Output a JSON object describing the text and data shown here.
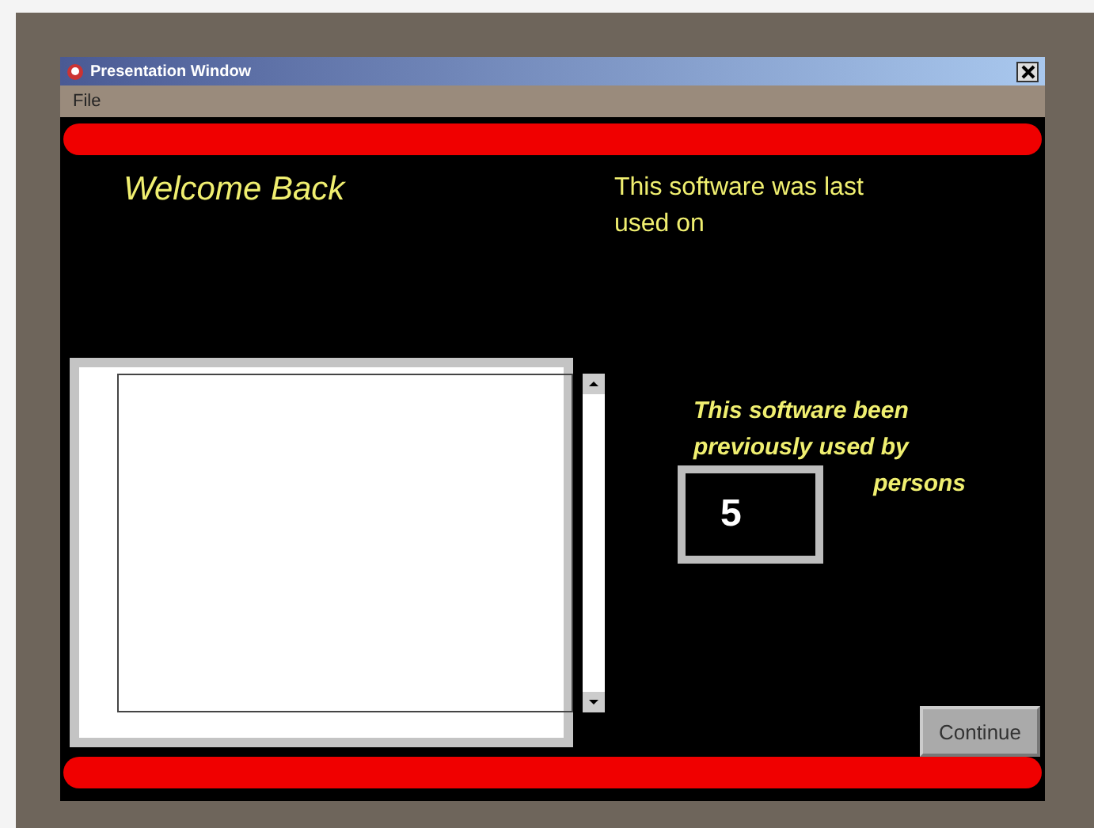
{
  "window": {
    "title": "Presentation Window"
  },
  "menu": [
    "File"
  ],
  "welcome": "Welcome Back",
  "last_used": "This software was last used on",
  "users_text": {
    "line_1": "This software been",
    "line_2": "previously used by",
    "line_3": "persons"
  },
  "user_count": "5",
  "continue_button": "Continue"
}
